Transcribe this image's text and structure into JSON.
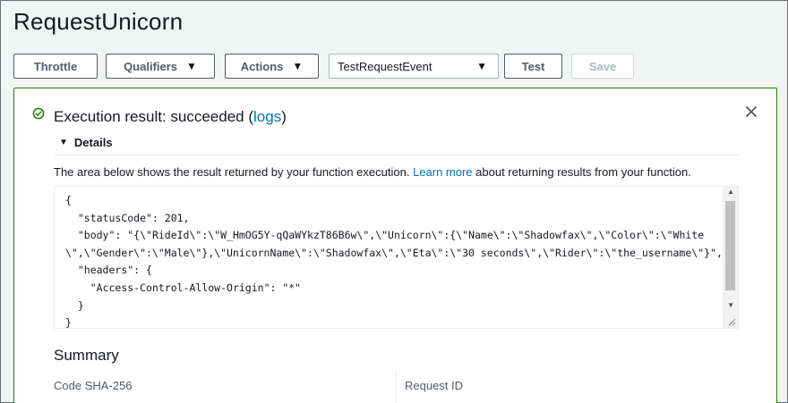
{
  "page": {
    "title": "RequestUnicorn"
  },
  "toolbar": {
    "throttle_label": "Throttle",
    "qualifiers_label": "Qualifiers",
    "actions_label": "Actions",
    "test_event_selected": "TestRequestEvent",
    "test_label": "Test",
    "save_label": "Save"
  },
  "result": {
    "title_prefix": "Execution result: succeeded (",
    "logs_link": "logs",
    "title_suffix": ")",
    "details_label": "Details",
    "description_prefix": "The area below shows the result returned by your function execution. ",
    "learn_more_link": "Learn more",
    "description_suffix": " about returning results from your function.",
    "code": "{\n  \"statusCode\": 201,\n  \"body\": \"{\\\"RideId\\\":\\\"W_HmOG5Y-qQaWYkzT86B6w\\\",\\\"Unicorn\\\":{\\\"Name\\\":\\\"Shadowfax\\\",\\\"Color\\\":\\\"White\\\",\\\"Gender\\\":\\\"Male\\\"},\\\"UnicornName\\\":\\\"Shadowfax\\\",\\\"Eta\\\":\\\"30 seconds\\\",\\\"Rider\\\":\\\"the_username\\\"}\",\n  \"headers\": {\n    \"Access-Control-Allow-Origin\": \"*\"\n  }\n}"
  },
  "summary": {
    "title": "Summary",
    "left_label": "Code SHA-256",
    "right_label": "Request ID"
  },
  "colors": {
    "success": "#1d8102",
    "link": "#0073bb",
    "border": "#545b64"
  },
  "icons": {
    "status": "check-circle-icon",
    "close": "close-icon",
    "caret": "caret-down-icon"
  }
}
